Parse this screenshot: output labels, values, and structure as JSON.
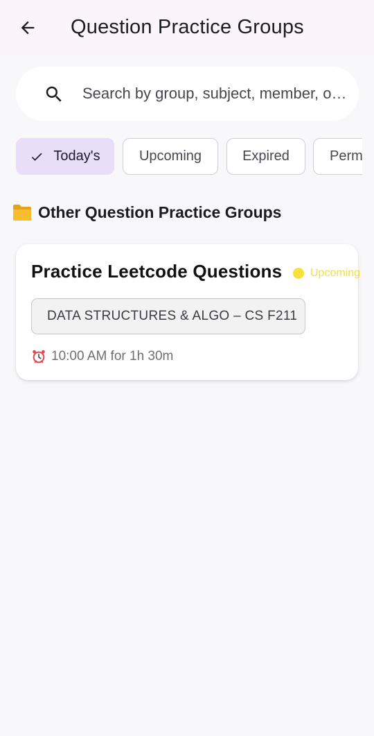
{
  "appbar": {
    "title": "Question Practice Groups",
    "back_icon": "arrow-left-icon"
  },
  "search": {
    "placeholder": "Search by group, subject, member, o…",
    "icon": "search-icon"
  },
  "filters": [
    {
      "label": "Today's",
      "selected": true
    },
    {
      "label": "Upcoming",
      "selected": false
    },
    {
      "label": "Expired",
      "selected": false
    },
    {
      "label": "Perm",
      "selected": false
    }
  ],
  "section": {
    "title": "Other Question Practice Groups",
    "icon": "folder-icon"
  },
  "groups": [
    {
      "title": "Practice Leetcode Questions",
      "status": "Upcoming",
      "status_color": "#f5e23a",
      "subject": "DATA STRUCTURES & ALGO – CS F211",
      "time": "10:00 AM for 1h 30m"
    }
  ],
  "colors": {
    "appbar_bg": "#fcf4fb",
    "page_bg": "#f8f7fa",
    "selected_chip_bg": "#e8def8"
  }
}
